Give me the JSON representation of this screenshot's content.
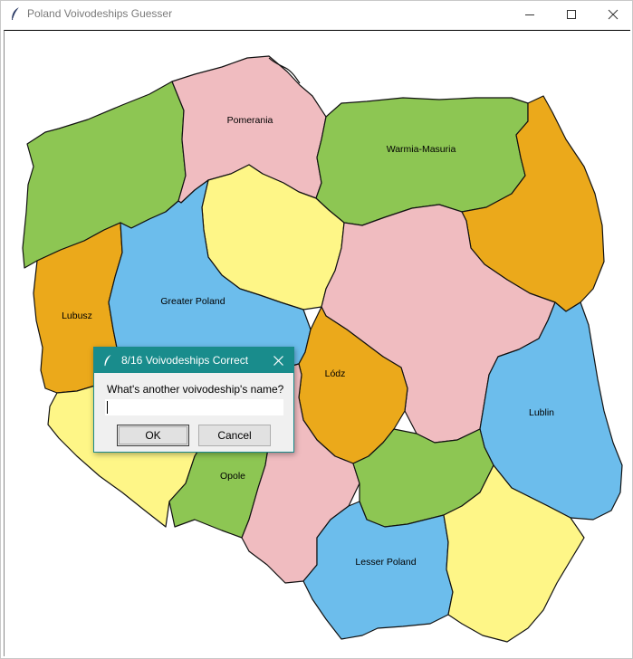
{
  "window": {
    "title": "Poland Voivodeships Guesser",
    "icon": "feather-icon",
    "controls": [
      "minimize-icon",
      "maximize-icon",
      "close-icon"
    ]
  },
  "map": {
    "colors": {
      "green": "#8dc653",
      "pink": "#f0bcc0",
      "yellow": "#fef687",
      "blue": "#6cbdec",
      "orange": "#eba91b"
    },
    "labels": {
      "pomerania": "Pomerania",
      "warmia_masuria": "Warmia-Masuria",
      "lubusz": "Lubusz",
      "greater_poland": "Greater Poland",
      "lodz": "Lódz",
      "lublin": "Lublin",
      "opole": "Opole",
      "lesser_poland": "Lesser Poland"
    }
  },
  "dialog": {
    "title": "8/16 Voivodeships Correct",
    "prompt": "What's another voivodeship's name?",
    "input_value": "",
    "ok_label": "OK",
    "cancel_label": "Cancel",
    "accent": "#198c8c"
  }
}
